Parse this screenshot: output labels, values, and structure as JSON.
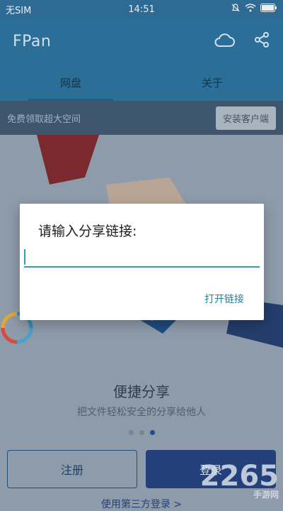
{
  "status_bar": {
    "carrier": "无SIM",
    "time": "14:51"
  },
  "app_bar": {
    "title": "FPan"
  },
  "tabs": [
    {
      "label": "网盘"
    },
    {
      "label": "关于"
    }
  ],
  "promo": {
    "text": "免费领取超大空间",
    "button": "安装客户端"
  },
  "feature": {
    "title": "便捷分享",
    "subtitle": "把文件轻松安全的分享给他人"
  },
  "buttons": {
    "register": "注册",
    "login": "登录",
    "third_party": "使用第三方登录 >"
  },
  "dialog": {
    "title": "请输入分享链接:",
    "input_value": "",
    "action": "打开链接"
  },
  "watermark": {
    "main": "2265",
    "sub": "手游网"
  },
  "icons": {
    "cloud": "cloud-icon",
    "share": "share-icon",
    "mute": "mute-icon",
    "wifi": "wifi-icon",
    "battery": "battery-icon"
  },
  "colors": {
    "app_bar": "#2b6e98",
    "accent": "#2aa3b3",
    "login_button": "#23407a",
    "dim_background": "#8e9bab"
  }
}
